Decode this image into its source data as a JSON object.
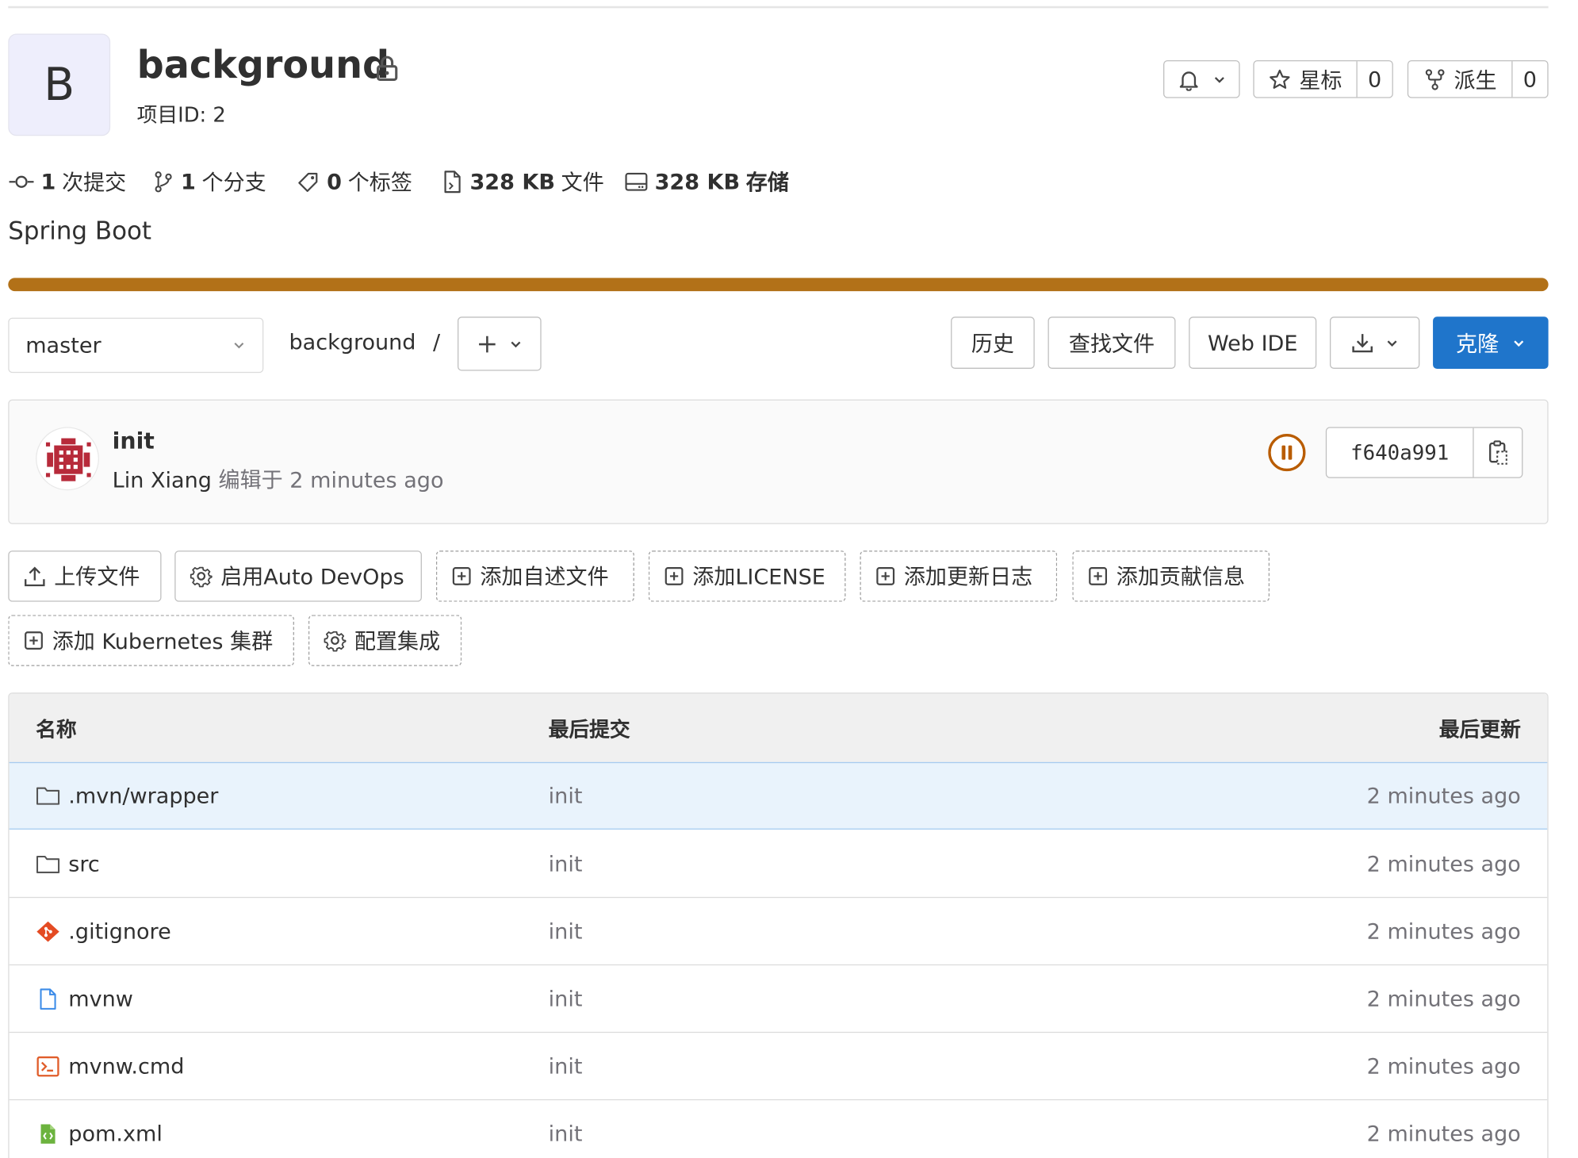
{
  "project": {
    "avatar_letter": "B",
    "name": "background",
    "project_id_text": "项目ID: 2",
    "star_label": "星标",
    "star_count": "0",
    "fork_label": "派生",
    "fork_count": "0"
  },
  "stats": {
    "commits_count": "1",
    "commits_label": "次提交",
    "branches_count": "1",
    "branches_label": "个分支",
    "tags_count": "0",
    "tags_label": "个标签",
    "files_size": "328 KB",
    "files_label": "文件",
    "storage_size": "328 KB",
    "storage_label": "存储"
  },
  "description": "Spring Boot",
  "language_bar_color": "#b27118",
  "toolbar": {
    "branch": "master",
    "breadcrumb": "background",
    "separator": "/",
    "history": "历史",
    "find_file": "查找文件",
    "web_ide": "Web IDE",
    "clone": "克隆"
  },
  "last_commit": {
    "title": "init",
    "author": "Lin Xiang",
    "edited_label": "编辑于",
    "time": "2 minutes ago",
    "sha": "f640a991",
    "pipeline_status": "paused"
  },
  "quick_actions": {
    "upload": "上传文件",
    "auto_devops": "启用Auto DevOps",
    "add_readme": "添加自述文件",
    "add_license": "添加LICENSE",
    "add_changelog": "添加更新日志",
    "add_contributing": "添加贡献信息",
    "add_kubernetes": "添加 Kubernetes 集群",
    "configure_integrations": "配置集成"
  },
  "file_table": {
    "headers": {
      "name": "名称",
      "last_commit": "最后提交",
      "last_update": "最后更新"
    },
    "rows": [
      {
        "name": ".mvn/wrapper",
        "icon": "folder-icon",
        "commit": "init",
        "updated": "2 minutes ago"
      },
      {
        "name": "src",
        "icon": "folder-icon",
        "commit": "init",
        "updated": "2 minutes ago"
      },
      {
        "name": ".gitignore",
        "icon": "git-icon",
        "commit": "init",
        "updated": "2 minutes ago"
      },
      {
        "name": "mvnw",
        "icon": "file-icon",
        "commit": "init",
        "updated": "2 minutes ago"
      },
      {
        "name": "mvnw.cmd",
        "icon": "terminal-file-icon",
        "commit": "init",
        "updated": "2 minutes ago"
      },
      {
        "name": "pom.xml",
        "icon": "xml-file-icon",
        "commit": "init",
        "updated": "2 minutes ago"
      }
    ]
  }
}
